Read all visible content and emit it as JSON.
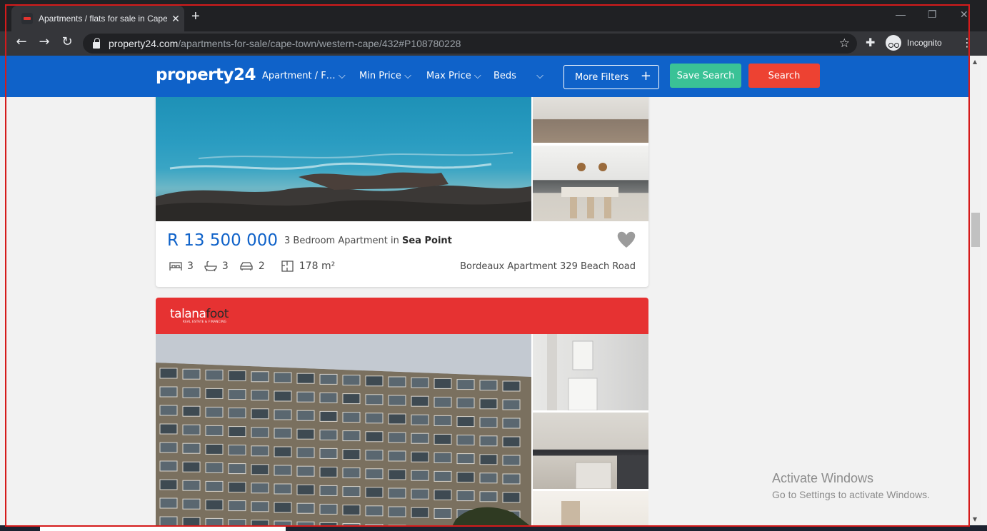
{
  "browser": {
    "tab_title": "Apartments / flats for sale in Cape Town",
    "tab_close": "✕",
    "new_tab": "+",
    "url_domain": "property24.com",
    "url_path": "/apartments-for-sale/cape-town/western-cape/432#P108780228",
    "incognito_label": "Incognito"
  },
  "header": {
    "logo": "property24",
    "filters": [
      {
        "label": "Apartment / F…"
      },
      {
        "label": "Min Price"
      },
      {
        "label": "Max Price"
      },
      {
        "label": "Beds"
      }
    ],
    "more_filters": "More Filters",
    "save_search": "Save Search",
    "search": "Search"
  },
  "listing1": {
    "price": "R 13 500 000",
    "title_prefix": "3 Bedroom Apartment in ",
    "suburb": "Sea Point",
    "bedrooms": "3",
    "bathrooms": "3",
    "parking": "2",
    "size": "178 m²",
    "address": "Bordeaux Apartment 329 Beach Road"
  },
  "listing2": {
    "agency_name": "talana",
    "agency_name2": "foot",
    "agency_tagline": "REAL ESTATE & FINANCING"
  },
  "watermark": {
    "line1": "Activate Windows",
    "line2": "Go to Settings to activate Windows."
  },
  "colors": {
    "brand_blue": "#0f62c9",
    "save_green": "#3ac296",
    "search_red": "#ed4232",
    "agency_red": "#e63232"
  }
}
